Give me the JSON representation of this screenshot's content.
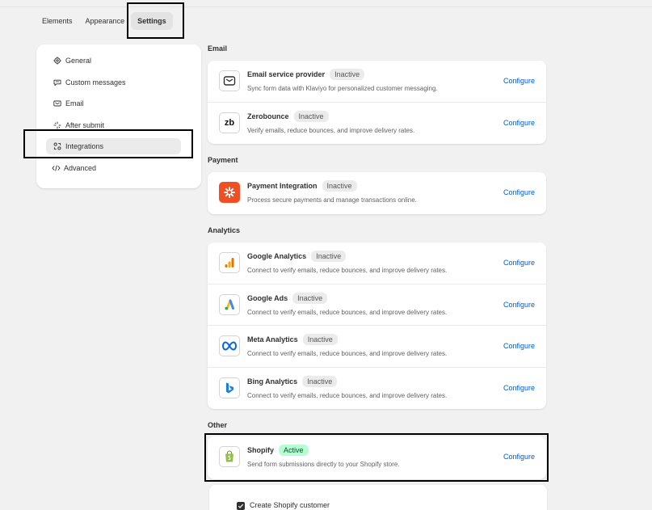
{
  "tabs": [
    {
      "label": "Elements"
    },
    {
      "label": "Appearance"
    },
    {
      "label": "Settings"
    }
  ],
  "sidebar": {
    "items": [
      {
        "label": "General",
        "icon": "gear-icon"
      },
      {
        "label": "Custom messages",
        "icon": "chat-icon"
      },
      {
        "label": "Email",
        "icon": "email-icon"
      },
      {
        "label": "After submit",
        "icon": "sparkle-icon"
      },
      {
        "label": "Integrations",
        "icon": "integrations-icon"
      },
      {
        "label": "Advanced",
        "icon": "code-icon"
      }
    ]
  },
  "sections": {
    "email": {
      "title": "Email",
      "rows": [
        {
          "name": "Email service provider",
          "badge": "Inactive",
          "desc": "Sync form data with Klaviyo for personalized customer messaging.",
          "action": "Configure"
        },
        {
          "name": "Zerobounce",
          "badge": "Inactive",
          "desc": "Verify emails, reduce bounces, and improve delivery rates.",
          "action": "Configure",
          "logo_text": "zb"
        }
      ]
    },
    "payment": {
      "title": "Payment",
      "rows": [
        {
          "name": "Payment Integration",
          "badge": "Inactive",
          "desc": "Process secure payments and manage transactions online.",
          "action": "Configure"
        }
      ]
    },
    "analytics": {
      "title": "Analytics",
      "rows": [
        {
          "name": "Google Analytics",
          "badge": "Inactive",
          "desc": "Connect to verify emails, reduce bounces, and improve delivery rates.",
          "action": "Configure"
        },
        {
          "name": "Google Ads",
          "badge": "Inactive",
          "desc": "Connect to verify emails, reduce bounces, and improve delivery rates.",
          "action": "Configure"
        },
        {
          "name": "Meta Analytics",
          "badge": "Inactive",
          "desc": "Connect to verify emails, reduce bounces, and improve delivery rates.",
          "action": "Configure"
        },
        {
          "name": "Bing Analytics",
          "badge": "Inactive",
          "desc": "Connect to verify emails, reduce bounces, and improve delivery rates.",
          "action": "Configure"
        }
      ]
    },
    "other": {
      "title": "Other",
      "rows": [
        {
          "name": "Shopify",
          "badge": "Active",
          "desc": "Send form submissions directly to your Shopify store.",
          "action": "Configure"
        }
      ]
    }
  },
  "shopify_options": {
    "create_customer_label": "Create Shopify customer",
    "create_customer_checked": true
  },
  "colors": {
    "link": "#005bd3",
    "active_badge_bg": "#b4fed2",
    "payment_logo": "#f04e23"
  }
}
